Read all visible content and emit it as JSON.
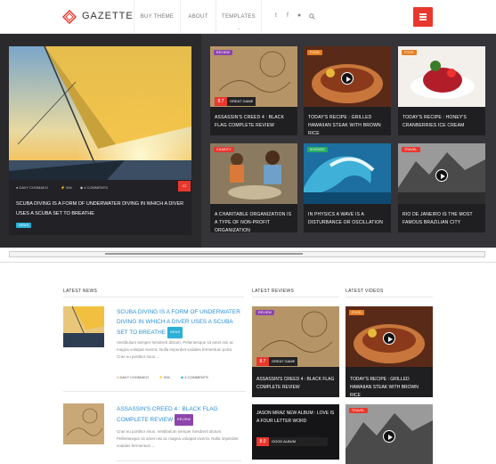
{
  "header": {
    "logo_text": "GAZETTE",
    "nav": [
      "BUY THEME",
      "ABOUT",
      "TEMPLATES"
    ],
    "social_icons": [
      "twitter-icon",
      "facebook-icon",
      "flickr-icon",
      "search-icon"
    ],
    "menu_icon": "hamburger-icon",
    "accent": "#e8382e"
  },
  "hero": {
    "author": "DAVY CHOMAKO",
    "views": "594",
    "comments": "4 COMMENTS",
    "title": "SCUBA DIVING IS A FORM OF UNDERWATER DIVING IN WHICH A DIVER USES A SCUBA SET TO BREATHE",
    "tag": "NEWS"
  },
  "tiles": [
    {
      "badge": "REVIEW",
      "score": "8.7",
      "score_label": "GREAT GAME",
      "title": "ASSASSIN'S CREED 4 : BLACK FLAG COMPLETE REVIEW"
    },
    {
      "badge": "FOOD",
      "title": "TODAY'S RECIPE : GRILLED HAWAIIAN STEAK WITH BROWN RICE"
    },
    {
      "badge": "FOOD",
      "title": "TODAY'S RECIPE : HONEY'S CRANBERRIES ICE CREAM"
    },
    {
      "badge": "CHARITY",
      "title": "A CHARITABLE ORGANIZATION IS A TYPE OF NON-PROFIT ORGANIZATION"
    },
    {
      "badge": "SCIENCE",
      "title": "IN PHYSICS A WAVE IS A DISTURBANCE OR OSCILLATION"
    },
    {
      "badge": "TRAVEL",
      "title": "RIO DE JANEIRO IS THE MOST FAMOUS BRAZILIAN CITY"
    }
  ],
  "latest_news": {
    "heading": "LATEST NEWS",
    "posts": [
      {
        "title": "SCUBA DIVING IS A FORM OF UNDERWATER DIVING IN WHICH A DIVER USES A SCUBA SET TO BREATHE",
        "tag": "NEWS",
        "excerpt": "Vestibulum semper hendrerit dictum. Pellentesque sit amet nisi ac magna volutpat viverra. Nulla imperdiet sodales fermentum porta. Cras eu porttitor risus ...",
        "author": "DAVY CHOMAKO",
        "views": "594",
        "comments": "4 COMMENTS"
      },
      {
        "title": "ASSASSIN'S CREED 4 : BLACK FLAG COMPLETE REVIEW",
        "tag": "REVIEW",
        "excerpt": "Cras eu porttitor risus. Vestibulum semper hendrerit dictum. Pellentesque sit amet nisi ac magna volutpat viverra. Nulla imperdiet sodales fermentum ..."
      }
    ]
  },
  "latest_reviews": {
    "heading": "LATEST REVIEWS",
    "items": [
      {
        "badge": "REVIEW",
        "score": "8.7",
        "score_label": "GREAT GAME",
        "title": "ASSASSIN'S CREED 4 : BLACK FLAG COMPLETE REVIEW"
      },
      {
        "title": "JASON MRAZ NEW ALBUM : LOVE IS A FOUR LETTER WORD",
        "score": "8.0",
        "score_label": "GOOD ALBUM"
      }
    ]
  },
  "latest_videos": {
    "heading": "LATEST VIDEOS",
    "items": [
      {
        "badge": "FOOD",
        "title": "TODAY'S RECIPE : GRILLED HAWAIIAN STEAK WITH BROWN RICE"
      },
      {
        "badge": "TRAVEL"
      }
    ]
  },
  "colors": {
    "dark_bg": "#2a292c",
    "link": "#2a8fd6",
    "news": "#2bb0d6",
    "review": "#8e44ad",
    "food": "#e67e22",
    "charity": "#e8382e",
    "science": "#27ae60",
    "travel": "#e8382e"
  }
}
